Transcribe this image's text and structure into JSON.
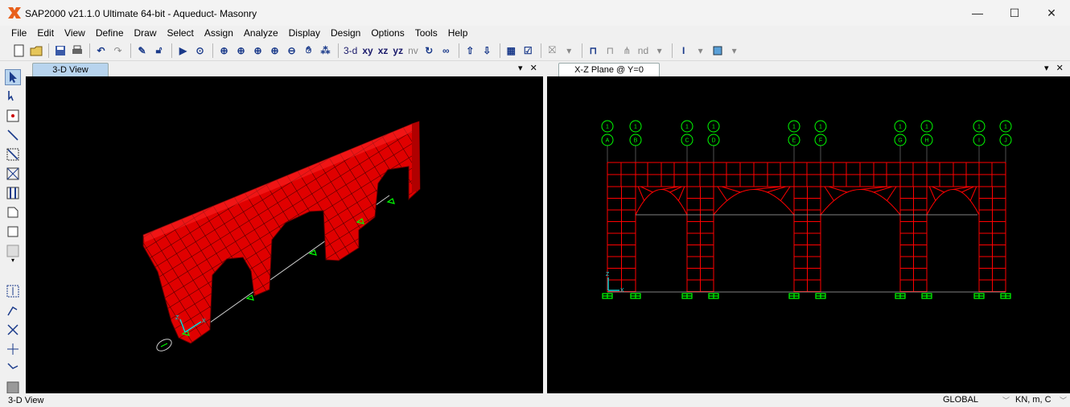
{
  "window": {
    "title": "SAP2000 v21.1.0 Ultimate 64-bit - Aqueduct- Masonry",
    "minimize_glyph": "—",
    "maximize_glyph": "☐",
    "close_glyph": "✕"
  },
  "menu": [
    "File",
    "Edit",
    "View",
    "Define",
    "Draw",
    "Select",
    "Assign",
    "Analyze",
    "Display",
    "Design",
    "Options",
    "Tools",
    "Help"
  ],
  "toolbar": {
    "view_3d": "3-d",
    "view_xy": "xy",
    "view_xz": "xz",
    "view_yz": "yz",
    "view_nv": "nv",
    "nd_label": "nd"
  },
  "panes": {
    "left": {
      "tab": "3-D View",
      "controls": "▾ ✕"
    },
    "right": {
      "tab": "X-Z Plane @ Y=0",
      "controls": "▾ ✕"
    }
  },
  "grid_bubbles": {
    "top": [
      "1",
      "1",
      "1",
      "1",
      "1",
      "1",
      "1",
      "1",
      "1",
      "1"
    ],
    "bottom": [
      "A",
      "B",
      "C",
      "D",
      "E",
      "F",
      "G",
      "H",
      "I",
      "J"
    ]
  },
  "axes_labels": {
    "x": "X",
    "z": "Z"
  },
  "statusbar": {
    "view": "3-D View",
    "coord_system": "GLOBAL",
    "units": "KN, m, C"
  },
  "colors": {
    "model_red": "#ff0000",
    "restraint_green": "#00ff00",
    "axis_cyan": "#00e0e0",
    "background": "#000000"
  }
}
